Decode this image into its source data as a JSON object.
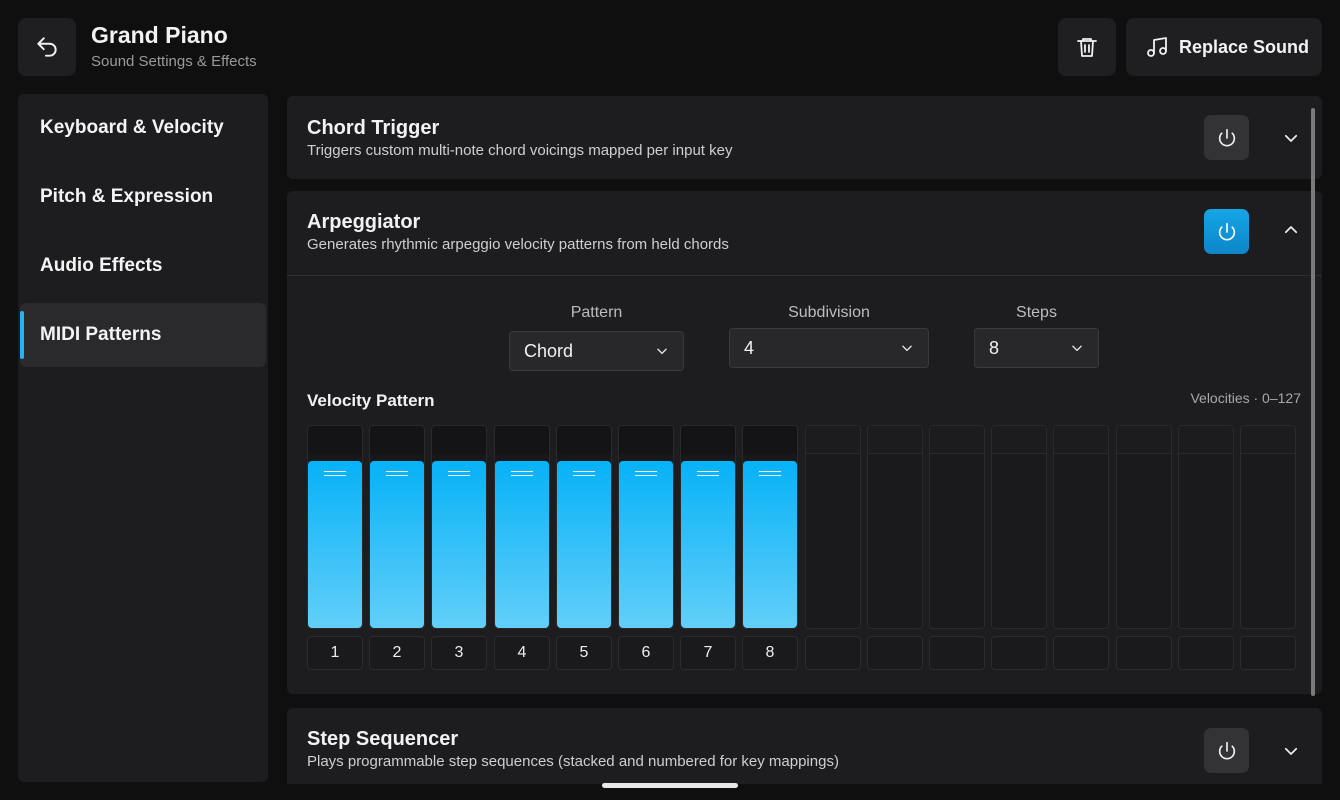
{
  "header": {
    "title": "Grand Piano",
    "subtitle": "Sound Settings & Effects",
    "replace_label": "Replace Sound"
  },
  "sidebar": {
    "items": [
      {
        "label": "Keyboard & Velocity",
        "active": false
      },
      {
        "label": "Pitch & Expression",
        "active": false
      },
      {
        "label": "Audio Effects",
        "active": false
      },
      {
        "label": "MIDI Patterns",
        "active": true
      }
    ]
  },
  "panels": {
    "chord_trigger": {
      "title": "Chord Trigger",
      "description": "Triggers custom multi-note chord voicings mapped per input key",
      "enabled": false,
      "expanded": false
    },
    "arpeggiator": {
      "title": "Arpeggiator",
      "description": "Generates rhythmic arpeggio velocity patterns from held chords",
      "enabled": true,
      "expanded": true,
      "pattern": {
        "label": "Pattern",
        "value": "Chord"
      },
      "subdivision": {
        "label": "Subdivision",
        "value": "4"
      },
      "steps": {
        "label": "Steps",
        "value": "8"
      },
      "velocity_title": "Velocity Pattern",
      "velocity_range": "Velocities · 0–127",
      "step_labels": [
        "1",
        "2",
        "3",
        "4",
        "5",
        "6",
        "7",
        "8"
      ],
      "velocity_levels": [
        0.82,
        0.82,
        0.82,
        0.82,
        0.82,
        0.82,
        0.82,
        0.82
      ],
      "total_slots": 16
    },
    "step_sequencer": {
      "title": "Step Sequencer",
      "description": "Plays programmable step sequences (stacked and numbered for key mappings)",
      "enabled": false,
      "expanded": false
    }
  },
  "colors": {
    "accent": "#27b2f1",
    "background": "#0f0f10",
    "panel": "#1d1d1f"
  }
}
